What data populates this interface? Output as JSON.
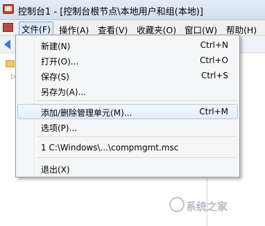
{
  "window": {
    "title": "控制台1 - [控制台根节点\\本地用户和组(本地)]"
  },
  "menubar": {
    "items": [
      {
        "label": "文件(F)"
      },
      {
        "label": "操作(A)"
      },
      {
        "label": "查看(V)"
      },
      {
        "label": "收藏夹(O)"
      },
      {
        "label": "窗口(W)"
      },
      {
        "label": "帮助(H)"
      }
    ]
  },
  "file_menu": {
    "new": {
      "label": "新建(N)",
      "shortcut": "Ctrl+N"
    },
    "open": {
      "label": "打开(O)...",
      "shortcut": "Ctrl+O"
    },
    "save": {
      "label": "保存(S)",
      "shortcut": "Ctrl+S"
    },
    "save_as": {
      "label": "另存为(A)..."
    },
    "add_remove_snapin": {
      "label": "添加/删除管理单元(M)...",
      "shortcut": "Ctrl+M"
    },
    "options": {
      "label": "选项(P)..."
    },
    "recent_file": {
      "label": "1 C:\\Windows\\...\\compmgmt.msc"
    },
    "exit": {
      "label": "退出(X)"
    }
  },
  "watermark": {
    "text": "系统之家"
  }
}
